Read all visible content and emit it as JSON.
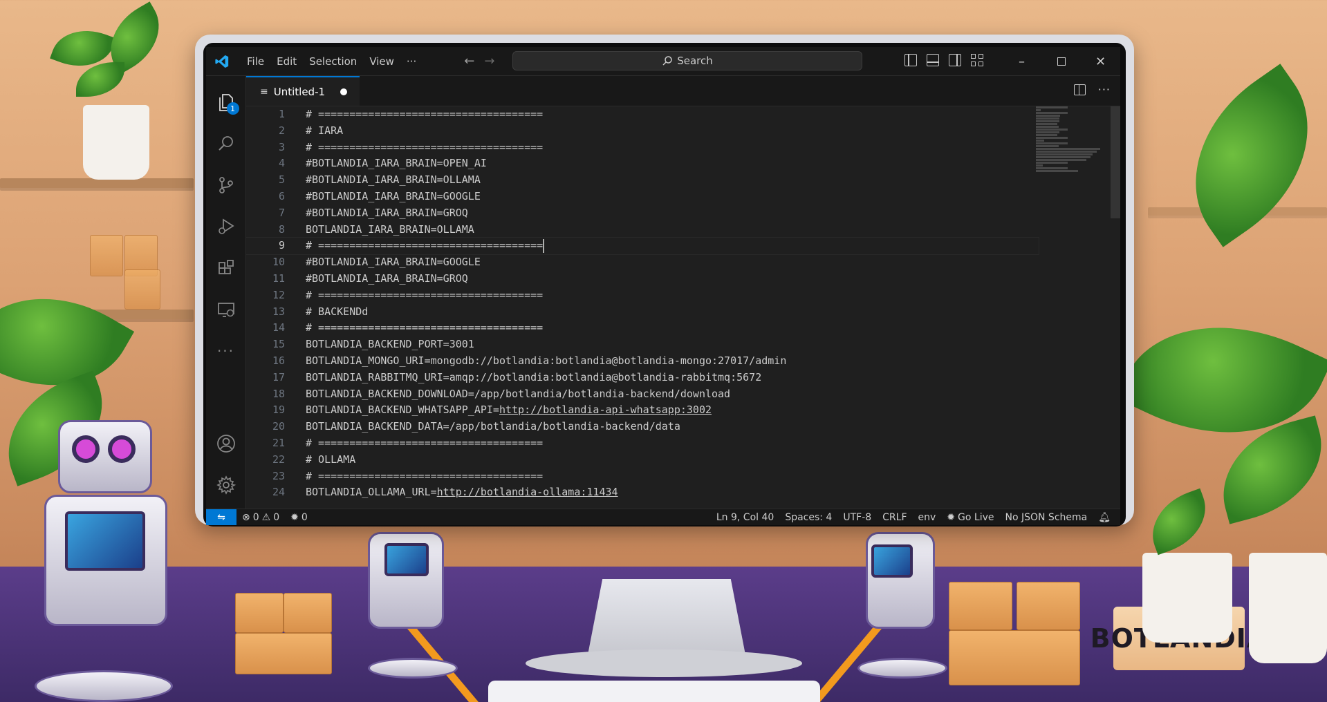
{
  "titlebar": {
    "menu": [
      "File",
      "Edit",
      "Selection",
      "View",
      "···"
    ],
    "search_label": "Search"
  },
  "activity_bar": {
    "explorer_badge": "1"
  },
  "tab": {
    "label": "Untitled-1"
  },
  "editor": {
    "current_line": 9,
    "lines": [
      {
        "n": "1",
        "text": "# ===================================="
      },
      {
        "n": "2",
        "text": "# IARA"
      },
      {
        "n": "3",
        "text": "# ===================================="
      },
      {
        "n": "4",
        "text": "#BOTLANDIA_IARA_BRAIN=OPEN_AI"
      },
      {
        "n": "5",
        "text": "#BOTLANDIA_IARA_BRAIN=OLLAMA"
      },
      {
        "n": "6",
        "text": "#BOTLANDIA_IARA_BRAIN=GOOGLE"
      },
      {
        "n": "7",
        "text": "#BOTLANDIA_IARA_BRAIN=GROQ"
      },
      {
        "n": "8",
        "text": "BOTLANDIA_IARA_BRAIN=OLLAMA"
      },
      {
        "n": "9",
        "text": "# ===================================="
      },
      {
        "n": "10",
        "text": "#BOTLANDIA_IARA_BRAIN=GOOGLE"
      },
      {
        "n": "11",
        "text": "#BOTLANDIA_IARA_BRAIN=GROQ"
      },
      {
        "n": "12",
        "text": "# ===================================="
      },
      {
        "n": "13",
        "text": "# BACKENDd"
      },
      {
        "n": "14",
        "text": "# ===================================="
      },
      {
        "n": "15",
        "text": "BOTLANDIA_BACKEND_PORT=3001"
      },
      {
        "n": "16",
        "text": "BOTLANDIA_MONGO_URI=mongodb://botlandia:botlandia@botlandia-mongo:27017/admin"
      },
      {
        "n": "17",
        "text": "BOTLANDIA_RABBITMQ_URI=amqp://botlandia:botlandia@botlandia-rabbitmq:5672"
      },
      {
        "n": "18",
        "text": "BOTLANDIA_BACKEND_DOWNLOAD=/app/botlandia/botlandia-backend/download"
      },
      {
        "n": "19",
        "text": "BOTLANDIA_BACKEND_WHATSAPP_API=",
        "link": "http://botlandia-api-whatsapp:3002"
      },
      {
        "n": "20",
        "text": "BOTLANDIA_BACKEND_DATA=/app/botlandia/botlandia-backend/data"
      },
      {
        "n": "21",
        "text": "# ===================================="
      },
      {
        "n": "22",
        "text": "# OLLAMA"
      },
      {
        "n": "23",
        "text": "# ===================================="
      },
      {
        "n": "24",
        "text": "BOTLANDIA_OLLAMA_URL=",
        "link": "http://botlandia-ollama:11434"
      }
    ]
  },
  "statusbar": {
    "errors": "0",
    "warnings": "0",
    "ports": "0",
    "position": "Ln 9, Col 40",
    "spaces": "Spaces: 4",
    "encoding": "UTF-8",
    "eol": "CRLF",
    "language": "env",
    "go_live": "Go Live",
    "schema": "No JSON Schema"
  },
  "scene": {
    "brand_box_text": "BOTLANDIA"
  },
  "colors": {
    "accent": "#0078d4",
    "editor_bg": "#1f1f1f",
    "chrome_bg": "#181818",
    "text": "#cccccc"
  }
}
